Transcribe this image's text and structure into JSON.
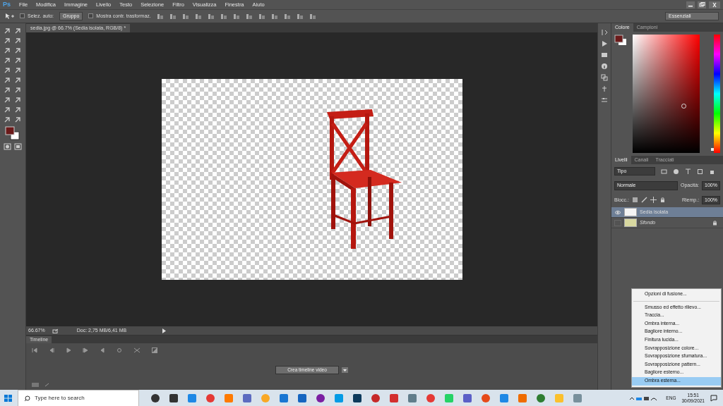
{
  "app": {
    "logo": "Ps",
    "menu": [
      "File",
      "Modifica",
      "Immagine",
      "Livello",
      "Testo",
      "Selezione",
      "Filtro",
      "Visualizza",
      "Finestra",
      "Aiuto"
    ]
  },
  "options": {
    "auto_select": {
      "label": "Selez. auto:",
      "checked": false
    },
    "group_select": "Gruppo",
    "show_transform": {
      "label": "Mostra contr. trasformaz.",
      "checked": false
    },
    "workspace": "Essenziali"
  },
  "document": {
    "tab": "sedia.jpg @ 66.7% (Sedia isolata, RGB/8) *",
    "zoom": "66.67%",
    "doc_info": "Doc: 2,75 MB/6,41 MB"
  },
  "timeline": {
    "title": "Timeline",
    "create_button": "Crea timeline video"
  },
  "color_panel": {
    "tabs": [
      {
        "label": "Colore",
        "selected": true
      },
      {
        "label": "Campioni",
        "selected": false
      }
    ],
    "hue_slider": {
      "level": 0.02
    }
  },
  "layers_panel": {
    "tabs": [
      {
        "label": "Livelli",
        "selected": true
      },
      {
        "label": "Canali",
        "selected": false
      },
      {
        "label": "Tracciati",
        "selected": false
      }
    ],
    "filter": "Tipo",
    "blend_mode": "Normale",
    "opacity_label": "Opacità:",
    "opacity": "100%",
    "lock_label": "Blocc.:",
    "fill_label": "Riemp.:",
    "fill": "100%",
    "layers": [
      {
        "name": "Sedia isolata",
        "selected": true,
        "visible": true,
        "locked": false,
        "italic": false
      },
      {
        "name": "Sfondo",
        "selected": false,
        "visible": false,
        "locked": true,
        "italic": true
      }
    ]
  },
  "context_menu": {
    "groups": [
      {
        "items": [
          {
            "label": "Opzioni di fusione...",
            "selected": false
          }
        ]
      },
      {
        "items": [
          {
            "label": "Smusso ed effetto rilievo...",
            "selected": false
          },
          {
            "label": "Traccia...",
            "selected": false
          },
          {
            "label": "Ombra interna...",
            "selected": false
          },
          {
            "label": "Bagliore interno...",
            "selected": false
          },
          {
            "label": "Finitura lucida...",
            "selected": false
          },
          {
            "label": "Sovrapposizione colore...",
            "selected": false
          },
          {
            "label": "Sovrapposizione sfumatura...",
            "selected": false
          },
          {
            "label": "Sovrapposizione pattern...",
            "selected": false
          },
          {
            "label": "Bagliore esterno...",
            "selected": false
          },
          {
            "label": "Ombra esterna...",
            "selected": true
          }
        ]
      }
    ]
  },
  "taskbar": {
    "search_placeholder": "Type here to search",
    "language": "ENG",
    "time": "15:51",
    "date": "30/09/2021"
  }
}
